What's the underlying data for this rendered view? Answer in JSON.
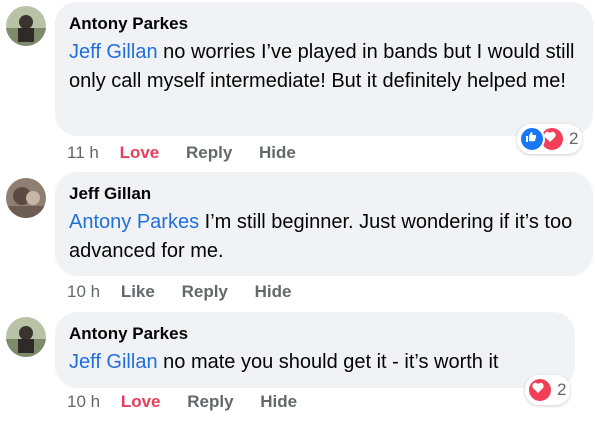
{
  "comments": [
    {
      "author": "Antony Parkes",
      "mention": "Jeff Gillan",
      "text": " no worries I’ve played in bands but I would still only call myself intermediate! But it definitely helped me!",
      "time": "11 h",
      "reaction_action": "Love",
      "reply": "Reply",
      "hide": "Hide",
      "reactions": [
        "like-icon",
        "love-icon"
      ],
      "reaction_count": "2"
    },
    {
      "author": "Jeff Gillan",
      "mention": "Antony Parkes",
      "text": " I’m still beginner. Just wondering if it’s too advanced for me.",
      "time": "10 h",
      "reaction_action": "Like",
      "reply": "Reply",
      "hide": "Hide"
    },
    {
      "author": "Antony Parkes",
      "mention": "Jeff Gillan",
      "text": " no mate you should get it - it’s worth it",
      "time": "10 h",
      "reaction_action": "Love",
      "reply": "Reply",
      "hide": "Hide",
      "reactions": [
        "love-icon"
      ],
      "reaction_count": "2"
    }
  ],
  "colors": {
    "bubble": "#f0f2f5",
    "mention": "#216fdb",
    "love": "#e4405b",
    "meta": "#65676b",
    "like_icon": "#1877f2",
    "love_icon": "#f33e58"
  }
}
